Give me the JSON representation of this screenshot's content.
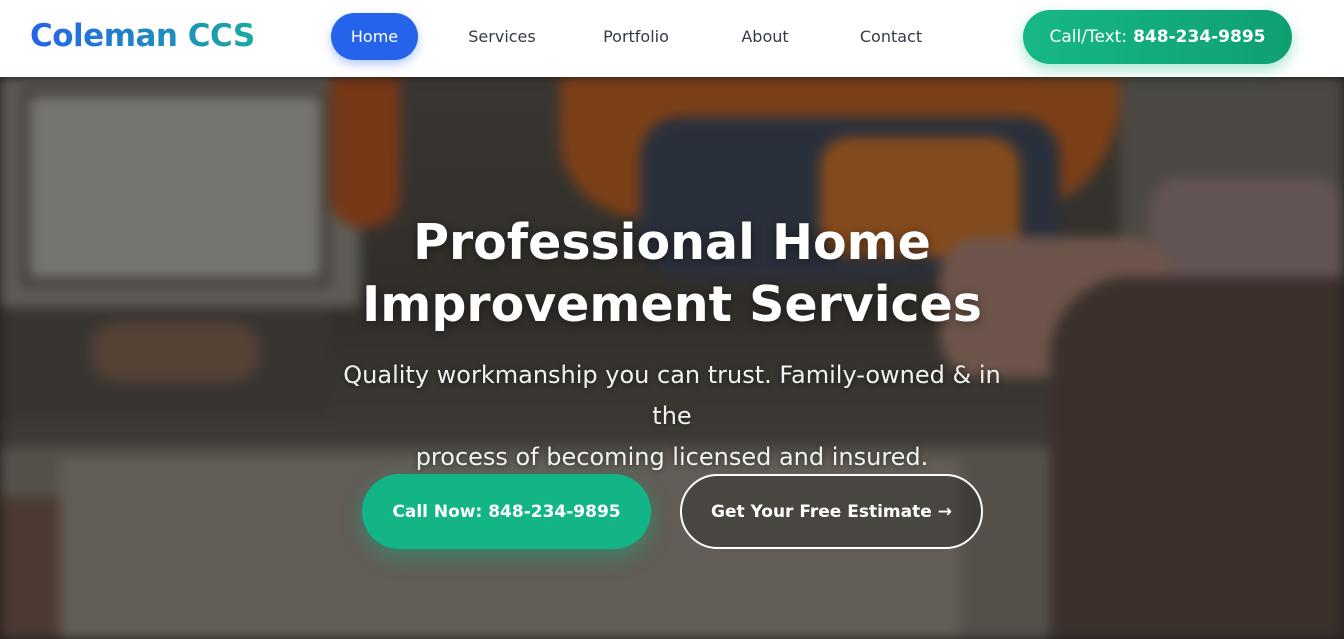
{
  "brand": {
    "logo_text": "Coleman CCS"
  },
  "nav": {
    "items": [
      {
        "label": "Home",
        "active": true
      },
      {
        "label": "Services"
      },
      {
        "label": "Portfolio"
      },
      {
        "label": "About"
      },
      {
        "label": "Contact"
      }
    ],
    "cta": {
      "prefix": "Call/Text:",
      "phone": "848-234-9895"
    }
  },
  "hero": {
    "title_line1": "Professional Home",
    "title_line2": "Improvement Services",
    "subtitle_line1": "Quality workmanship you can trust. Family-owned & in the",
    "subtitle_line2": "process of becoming licensed and insured.",
    "primary_button": "Call Now: 848-234-9895",
    "secondary_button": "Get Your Free Estimate",
    "secondary_arrow": "→"
  },
  "colors": {
    "brand_blue": "#2563eb",
    "brand_green": "#10b981",
    "nav_bg": "#ffffff"
  }
}
